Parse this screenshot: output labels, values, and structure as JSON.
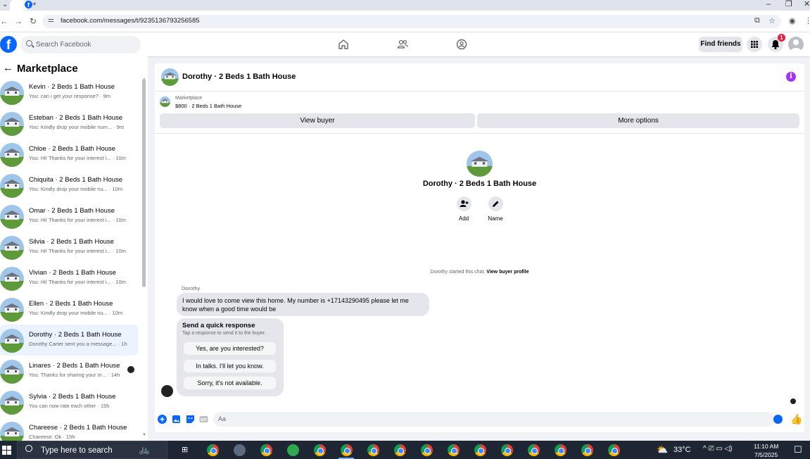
{
  "browser": {
    "url": "facebook.com/messages/t/9235136793256585",
    "tab_favicon": "f",
    "new_tab_symbol": "+",
    "tab_menu_symbol": "⌄"
  },
  "fb_header": {
    "logo_letter": "f",
    "search_placeholder": "Search Facebook",
    "find_friends_label": "Find friends",
    "notification_count": "1"
  },
  "sidebar": {
    "title": "Marketplace",
    "conversations": [
      {
        "title": "Kevin · 2 Beds 1 Bath House",
        "subtitle": "You: can i get your response? · 9m"
      },
      {
        "title": "Esteban · 2 Beds 1 Bath House",
        "subtitle": "You: Kindly drop your mobile num... · 9m"
      },
      {
        "title": "Chloe · 2 Beds 1 Bath House",
        "subtitle": "You: Hi! Thanks for your interest i... · 10m"
      },
      {
        "title": "Chiquita · 2 Beds 1 Bath House",
        "subtitle": "You: Kindly drop your mobile nu... · 10m"
      },
      {
        "title": "Omar · 2 Beds 1 Bath House",
        "subtitle": "You: Hi! Thanks for your interest i... · 10m"
      },
      {
        "title": "Silvia · 2 Beds 1 Bath House",
        "subtitle": "You: Hi! Thanks for your interest i... · 10m"
      },
      {
        "title": "Vivian · 2 Beds 1 Bath House",
        "subtitle": "You: Hi! Thanks for your interest i... · 10m"
      },
      {
        "title": "Ellen · 2 Beds 1 Bath House",
        "subtitle": "You: Kindly drop your mobile nu... · 10m"
      },
      {
        "title": "Dorothy · 2 Beds 1 Bath House",
        "subtitle": "Dorothy Carter sent you a message... · 1h"
      },
      {
        "title": "Linares · 2 Beds 1 Bath House",
        "subtitle": "You: Thanks for sharing your m... · 14h"
      },
      {
        "title": "Sylvia · 2 Beds 1 Bath House",
        "subtitle": "You can now rate each other · 15h"
      },
      {
        "title": "Chareese · 2 Beds 1 Bath House",
        "subtitle": "Chareese: Ok · 15h"
      }
    ]
  },
  "chat": {
    "title": "Dorothy · 2 Beds 1 Bath House",
    "marketplace_label": "Marketplace",
    "listing_price_title": "$800 · 2 Beds 1 Bath House",
    "view_buyer_label": "View buyer",
    "more_options_label": "More options",
    "center_title": "Dorothy · 2 Beds 1 Bath House",
    "add_label": "Add",
    "name_label": "Name",
    "started_text": "Dorothy started this chat.",
    "view_profile_link": "View buyer profile",
    "sender_name": "Dorothy",
    "message_text": "I would love to come view this home. My number is +17143290495 please let me know when a good time would be",
    "quick_response_title": "Send a quick response",
    "quick_response_subtitle": "Tap a response to send it to the buyer.",
    "quick_replies": [
      "Yes, are you interested?",
      "In talks. I'll let you know.",
      "Sorry, it's not available."
    ],
    "composer_placeholder": "Aa"
  },
  "taskbar": {
    "search_placeholder": "Type here to search",
    "weather": "33°C",
    "time": "11:10 AM",
    "date": "7/5/2025"
  },
  "colors": {
    "fb_blue": "#0866ff",
    "notification_red": "#e41e3f",
    "info_purple": "#a033ff",
    "active_row": "#ebf3ff"
  }
}
